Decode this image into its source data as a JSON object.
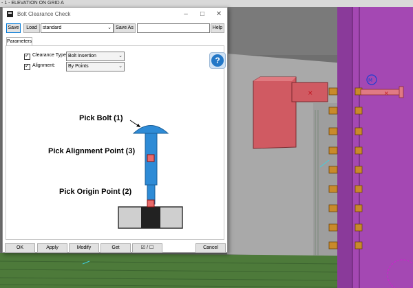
{
  "viewport": {
    "title": "- 1 - ELEVATION ON GRID A"
  },
  "dialog": {
    "title": "Bolt Clearance Check",
    "toolbar": {
      "save_label": "Save",
      "load_label": "Load",
      "preset_value": "standard",
      "save_as_label": "Save As",
      "save_as_name": "",
      "help_label": "Help"
    },
    "tab_label": "Parameters",
    "clearance_type_label": "Clearance Type:",
    "clearance_type_value": "Bolt Insertion",
    "alignment_label": "Alignment:",
    "alignment_value": "By Points",
    "help_icon": "question-mark-icon",
    "diagram": {
      "pick_bolt": "Pick Bolt (1)",
      "pick_alignment": "Pick Alignment Point (3)",
      "pick_origin": "Pick Origin Point (2)"
    },
    "buttons": {
      "ok": "OK",
      "apply": "Apply",
      "modify": "Modify",
      "get": "Get",
      "toggle": "☑ / ☐",
      "cancel": "Cancel"
    }
  },
  "colors": {
    "bolt_blue": "#2e8bd6",
    "marker_red": "#e05050",
    "steel_purple": "#a448b3",
    "plate_red": "#d05a62",
    "nut_orange": "#c98a2a",
    "wall_gray": "#a8a8a8"
  }
}
